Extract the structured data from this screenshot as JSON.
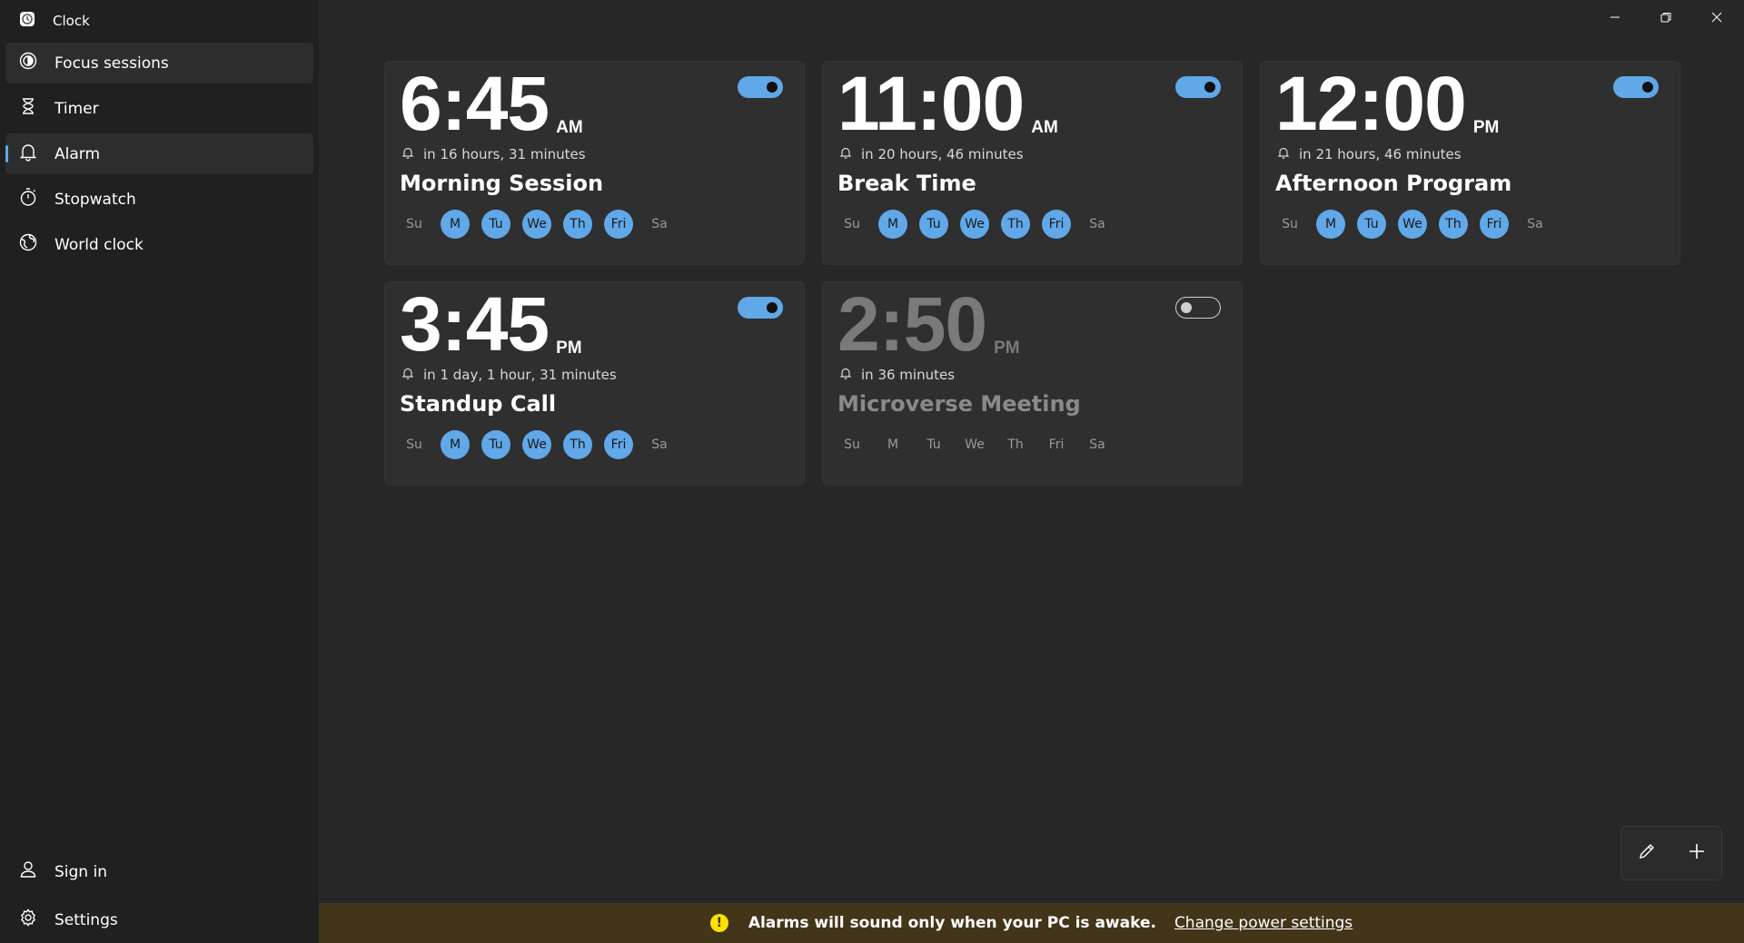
{
  "app": {
    "title": "Clock"
  },
  "nav": {
    "items": [
      {
        "id": "focus",
        "label": "Focus sessions",
        "icon": "focus-icon"
      },
      {
        "id": "timer",
        "label": "Timer",
        "icon": "hourglass-icon"
      },
      {
        "id": "alarm",
        "label": "Alarm",
        "icon": "bell-icon"
      },
      {
        "id": "stopwatch",
        "label": "Stopwatch",
        "icon": "stopwatch-icon"
      },
      {
        "id": "worldclock",
        "label": "World clock",
        "icon": "globe-icon"
      }
    ],
    "bottom": [
      {
        "id": "signin",
        "label": "Sign in",
        "icon": "person-icon"
      },
      {
        "id": "settings",
        "label": "Settings",
        "icon": "gear-icon"
      }
    ]
  },
  "alarms": [
    {
      "time": "6:45",
      "ampm": "AM",
      "remaining": "in 16 hours, 31 minutes",
      "name": "Morning Session",
      "enabled": true,
      "days": [
        {
          "label": "Su",
          "on": false
        },
        {
          "label": "M",
          "on": true
        },
        {
          "label": "Tu",
          "on": true
        },
        {
          "label": "We",
          "on": true
        },
        {
          "label": "Th",
          "on": true
        },
        {
          "label": "Fri",
          "on": true
        },
        {
          "label": "Sa",
          "on": false
        }
      ]
    },
    {
      "time": "11:00",
      "ampm": "AM",
      "remaining": "in 20 hours, 46 minutes",
      "name": "Break Time",
      "enabled": true,
      "days": [
        {
          "label": "Su",
          "on": false
        },
        {
          "label": "M",
          "on": true
        },
        {
          "label": "Tu",
          "on": true
        },
        {
          "label": "We",
          "on": true
        },
        {
          "label": "Th",
          "on": true
        },
        {
          "label": "Fri",
          "on": true
        },
        {
          "label": "Sa",
          "on": false
        }
      ]
    },
    {
      "time": "12:00",
      "ampm": "PM",
      "remaining": "in 21 hours, 46 minutes",
      "name": "Afternoon Program",
      "enabled": true,
      "days": [
        {
          "label": "Su",
          "on": false
        },
        {
          "label": "M",
          "on": true
        },
        {
          "label": "Tu",
          "on": true
        },
        {
          "label": "We",
          "on": true
        },
        {
          "label": "Th",
          "on": true
        },
        {
          "label": "Fri",
          "on": true
        },
        {
          "label": "Sa",
          "on": false
        }
      ]
    },
    {
      "time": "3:45",
      "ampm": "PM",
      "remaining": "in 1 day, 1 hour, 31 minutes",
      "name": "Standup Call",
      "enabled": true,
      "days": [
        {
          "label": "Su",
          "on": false
        },
        {
          "label": "M",
          "on": true
        },
        {
          "label": "Tu",
          "on": true
        },
        {
          "label": "We",
          "on": true
        },
        {
          "label": "Th",
          "on": true
        },
        {
          "label": "Fri",
          "on": true
        },
        {
          "label": "Sa",
          "on": false
        }
      ]
    },
    {
      "time": "2:50",
      "ampm": "PM",
      "remaining": "in 36 minutes",
      "name": "Microverse Meeting",
      "enabled": false,
      "days": [
        {
          "label": "Su",
          "on": false
        },
        {
          "label": "M",
          "on": false
        },
        {
          "label": "Tu",
          "on": false
        },
        {
          "label": "We",
          "on": false
        },
        {
          "label": "Th",
          "on": false
        },
        {
          "label": "Fri",
          "on": false
        },
        {
          "label": "Sa",
          "on": false
        }
      ]
    }
  ],
  "infobar": {
    "message": "Alarms will sound only when your PC is awake.",
    "link": "Change power settings"
  },
  "colors": {
    "accent": "#60a8e8",
    "infobar_bg": "#433519",
    "warning": "#fce100"
  }
}
